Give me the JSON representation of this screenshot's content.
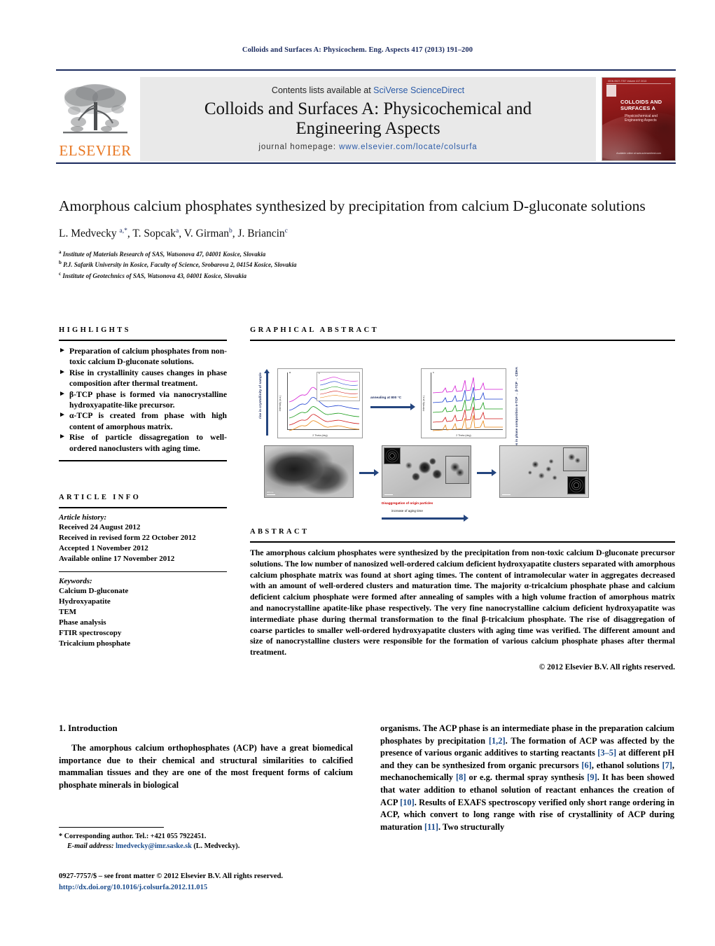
{
  "running_head": "Colloids and Surfaces A: Physicochem. Eng. Aspects 417 (2013) 191–200",
  "masthead": {
    "contents_prefix": "Contents lists available at ",
    "contents_link": "SciVerse ScienceDirect",
    "journal_name_line1": "Colloids and Surfaces A: Physicochemical and",
    "journal_name_line2": "Engineering Aspects",
    "homepage_label": "journal homepage: ",
    "homepage_url": "www.elsevier.com/locate/colsurfa",
    "publisher_wordmark": "ELSEVIER",
    "cover": {
      "issn_line": "ISSN 0927-7757 Volume 417  2013",
      "title_line1": "COLLOIDS AND",
      "title_line2": "SURFACES A",
      "sub_line1": "Physicochemical and",
      "sub_line2": "Engineering Aspects",
      "bottom_line": "Available online at www.sciencedirect.com"
    }
  },
  "article": {
    "title": "Amorphous calcium phosphates synthesized by precipitation from calcium D-gluconate solutions",
    "authors_html": "L. Medvecky <sup>a,*</sup>, T. Sopcak<sup>a</sup>, V. Girman<sup>b</sup>, J. Briancin<sup>c</sup>",
    "affiliations": [
      {
        "marker": "a",
        "text": "Institute of Materials Research of SAS, Watsonova 47, 04001 Kosice, Slovakia"
      },
      {
        "marker": "b",
        "text": "P.J. Safarik University in Kosice, Faculty of Science, Srobarova 2, 04154 Kosice, Slovakia"
      },
      {
        "marker": "c",
        "text": "Institute of Geotechnics of SAS, Watsonova 43, 04001 Kosice, Slovakia"
      }
    ]
  },
  "highlights": {
    "heading": "HIGHLIGHTS",
    "bullet_glyph": "►",
    "items": [
      "Preparation of calcium phosphates from non-toxic calcium D-gluconate solutions.",
      "Rise in crystallinity causes changes in phase composition after thermal treatment.",
      "β-TCP phase is formed via nanocrystalline hydroxyapatite-like precursor.",
      "α-TCP is created from phase with high content of amorphous matrix.",
      "Rise of particle dissagregation to well-ordered nanoclusters with aging time."
    ]
  },
  "graphical_abstract": {
    "heading": "GRAPHICAL ABSTRACT",
    "left_axis_label": "rise in crystallinity of sample",
    "right_axis_label": "changes in phase composition α-TCP → β-TCP → CDHA",
    "top_arrow_label": "annealing at 800 °C",
    "bottom_red_label": "Disaggregation of origin particles",
    "bottom_arrow_label": "increase of aging time",
    "xrd_left": {
      "panel_tag": "a",
      "xlabel": "2 Theta (deg)",
      "ylabel": "Intensity (a.u.)",
      "inset_tag": "b"
    },
    "xrd_right": {
      "panel_tag": "c",
      "xlabel": "2 Theta (deg)",
      "ylabel": "Intensity (a.u.)"
    },
    "tem_scale": "200 nm"
  },
  "article_info": {
    "heading": "ARTICLE INFO",
    "history_label": "Article history:",
    "history": [
      "Received 24 August 2012",
      "Received in revised form 22 October 2012",
      "Accepted 1 November 2012",
      "Available online 17 November 2012"
    ],
    "keywords_label": "Keywords:",
    "keywords": [
      "Calcium D-gluconate",
      "Hydroxyapatite",
      "TEM",
      "Phase analysis",
      "FTIR spectroscopy",
      "Tricalcium phosphate"
    ]
  },
  "abstract": {
    "heading": "ABSTRACT",
    "text": "The amorphous calcium phosphates were synthesized by the precipitation from non-toxic calcium D-gluconate precursor solutions. The low number of nanosized well-ordered calcium deficient hydroxyapatite clusters separated with amorphous calcium phosphate matrix was found at short aging times. The content of intramolecular water in aggregates decreased with an amount of well-ordered clusters and maturation time. The majority α-tricalcium phosphate phase and calcium deficient calcium phosphate were formed after annealing of samples with a high volume fraction of amorphous matrix and nanocrystalline apatite-like phase respectively. The very fine nanocrystalline calcium deficient hydroxyapatite was intermediate phase during thermal transformation to the final β-tricalcium phosphate. The rise of disaggregation of coarse particles to smaller well-ordered hydroxyapatite clusters with aging time was verified. The different amount and size of nanocrystalline clusters were responsible for the formation of various calcium phosphate phases after thermal treatment.",
    "copyright": "© 2012 Elsevier B.V. All rights reserved."
  },
  "introduction": {
    "section_number_title": "1. Introduction",
    "left_paragraph": "The amorphous calcium orthophosphates (ACP) have a great biomedical importance due to their chemical and structural similarities to calcified mammalian tissues and they are one of the most frequent forms of calcium phosphate minerals in biological",
    "right_paragraph_parts": [
      "organisms. The ACP phase is an intermediate phase in the preparation calcium phosphates by precipitation ",
      "[1,2]",
      ". The formation of ACP was affected by the presence of various organic additives to starting reactants ",
      "[3–5]",
      " at different pH and they can be synthesized from organic precursors ",
      "[6]",
      ", ethanol solutions ",
      "[7]",
      ", mechanochemically ",
      "[8]",
      " or e.g. thermal spray synthesis ",
      "[9]",
      ". It has been showed that water addition to ethanol solution of reactant enhances the creation of ACP ",
      "[10]",
      ". Results of EXAFS spectroscopy verified only short range ordering in ACP, which convert to long range with rise of crystallinity of ACP during maturation ",
      "[11]",
      ". Two structurally"
    ]
  },
  "footnote": {
    "corresponding_marker": "*",
    "corresponding_text": " Corresponding author. Tel.: +421 055 7922451.",
    "email_label": "E-mail address:",
    "email": " lmedvecky@imr.saske.sk",
    "email_suffix": " (L. Medvecky)."
  },
  "front_matter": {
    "line1": "0927-7757/$ – see front matter © 2012 Elsevier B.V. All rights reserved.",
    "doi": "http://dx.doi.org/10.1016/j.colsurfa.2012.11.015"
  },
  "colors": {
    "navy": "#1a2a5e",
    "link_blue": "#2b5ba8",
    "elsevier_orange": "#E87722",
    "cover_red": "#8d1b1b"
  }
}
